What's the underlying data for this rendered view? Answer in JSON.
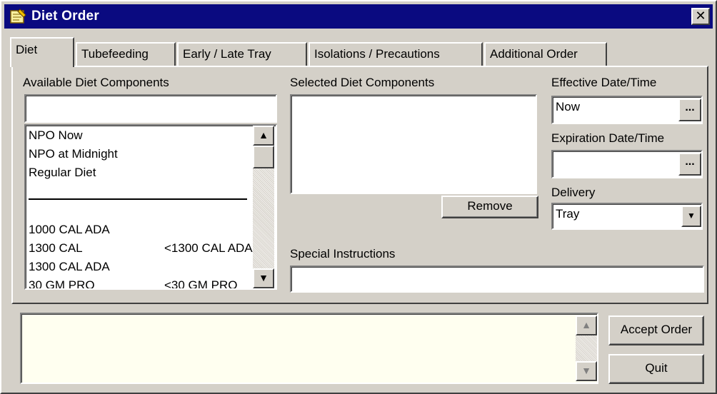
{
  "window": {
    "title": "Diet Order",
    "close_label": "✕"
  },
  "tabs": [
    {
      "label": "Diet",
      "active": true
    },
    {
      "label": "Tubefeeding",
      "active": false
    },
    {
      "label": "Early / Late Tray",
      "active": false
    },
    {
      "label": "Isolations / Precautions",
      "active": false
    },
    {
      "label": "Additional Order",
      "active": false
    }
  ],
  "available": {
    "label": "Available Diet Components",
    "search_value": "",
    "items_top": [
      "NPO Now",
      "NPO at Midnight",
      "Regular Diet"
    ],
    "items_bottom": [
      {
        "name": "1000 CAL ADA",
        "sub": ""
      },
      {
        "name": "1300 CAL",
        "sub": "<1300 CAL ADA"
      },
      {
        "name": "1300 CAL ADA",
        "sub": ""
      },
      {
        "name": "30 GM PRO",
        "sub": "<30 GM PRO"
      }
    ]
  },
  "selected": {
    "label": "Selected Diet Components",
    "remove_label": "Remove"
  },
  "effective": {
    "label": "Effective Date/Time",
    "value": "Now",
    "button": "..."
  },
  "expiration": {
    "label": "Expiration Date/Time",
    "value": "",
    "button": "..."
  },
  "delivery": {
    "label": "Delivery",
    "value": "Tray"
  },
  "special": {
    "label": "Special Instructions",
    "value": ""
  },
  "order_text": "",
  "buttons": {
    "accept": "Accept Order",
    "quit": "Quit"
  },
  "icons": {
    "title": "notepad-icon",
    "close": "close-icon",
    "scroll_up": "arrow-up-icon",
    "scroll_down": "arrow-down-icon",
    "dropdown": "chevron-down-icon"
  },
  "colors": {
    "titlebar": "#0a0a80",
    "face": "#d4d0c8",
    "order_box": "#fffff0"
  }
}
